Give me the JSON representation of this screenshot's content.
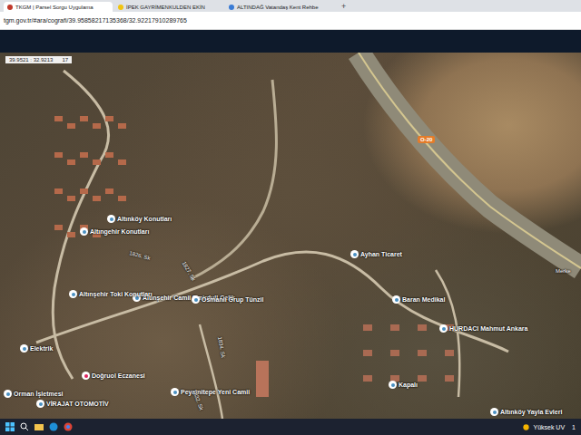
{
  "browser": {
    "tabs": [
      {
        "label": "TKGM | Parsel Sorgu Uygulama",
        "selected": true
      },
      {
        "label": "İPEK GAYRİMENKULDEN EKİN",
        "selected": false
      },
      {
        "label": "ALTINDAĞ Vatandaş Kent Rehbe",
        "selected": false
      }
    ],
    "new_tab": "+",
    "address": "tgm.gov.tr/#ara/cografi/39.95858217135368/32.92217910289765"
  },
  "map": {
    "coordinates": "39.9521 : 32.9213",
    "zoom": "17",
    "highway_shield": "O-20",
    "labels": [
      {
        "text": "Altınköy Konutları",
        "kind": "place"
      },
      {
        "text": "Altıngehir Konutları",
        "kind": "place"
      },
      {
        "text": "1826. Sk",
        "kind": "street"
      },
      {
        "text": "1827. Sk",
        "kind": "street"
      },
      {
        "text": "Altınşehir Camii Emirdull Çelik",
        "kind": "place"
      },
      {
        "text": "Ayhan Ticaret",
        "kind": "place"
      },
      {
        "text": "Osmanlı Grup Tünzil",
        "kind": "place"
      },
      {
        "text": "Baran Medikal",
        "kind": "place"
      },
      {
        "text": "Altınşehir Toki Konutları",
        "kind": "place"
      },
      {
        "text": "HURDACI Mahmut Ankara",
        "kind": "place"
      },
      {
        "text": "Elektrik",
        "kind": "place"
      },
      {
        "text": "Doğruol Eczanesi",
        "kind": "pharmacy"
      },
      {
        "text": "Peyamitepe Yeni Camii",
        "kind": "place"
      },
      {
        "text": "Kapalı",
        "kind": "place"
      },
      {
        "text": "VİRAJAT OTOMOTİV",
        "kind": "place"
      },
      {
        "text": "Altınköy Yayla Evleri",
        "kind": "place"
      },
      {
        "text": "Orman İşletmesi",
        "kind": "place"
      },
      {
        "text": "1832. Sk",
        "kind": "street"
      },
      {
        "text": "1834. Sk",
        "kind": "street"
      },
      {
        "text": "Merke",
        "kind": "street"
      }
    ]
  },
  "taskbar": {
    "weather": "Yüksek UV",
    "clock": "1"
  }
}
